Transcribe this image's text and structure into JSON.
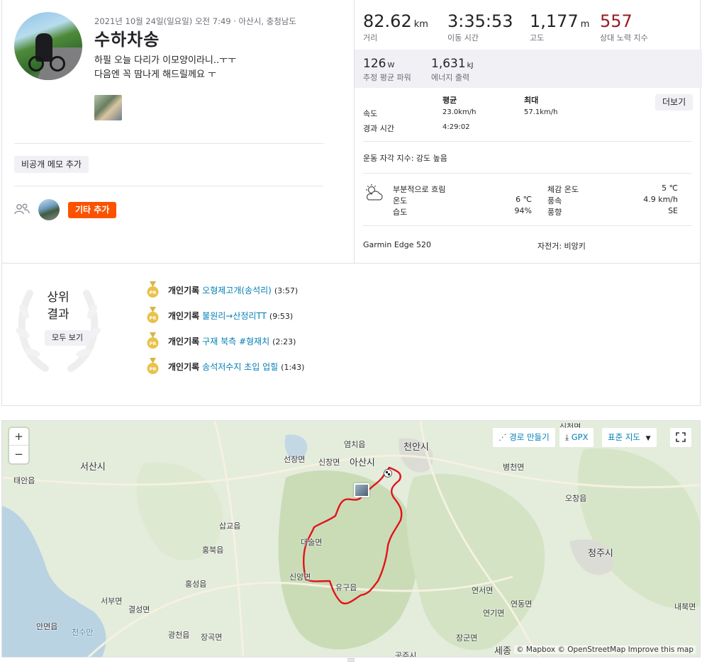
{
  "activity": {
    "meta": "2021년 10월 24일(일요일) 오전 7:49 · 아산시, 충청남도",
    "title": "수하차송",
    "description_line1": "하필 오늘 다리가 이모양이라니..ㅜㅜ",
    "description_line2": "다음엔 꼭 땀나게 해드릴께요 ㅜ",
    "private_note_button": "비공개 메모 추가",
    "add_other_button": "기타 추가"
  },
  "stats": [
    {
      "value": "82.62",
      "unit": "km",
      "label": "거리"
    },
    {
      "value": "3:35:53",
      "unit": "",
      "label": "이동 시간"
    },
    {
      "value": "1,177",
      "unit": "m",
      "label": "고도"
    },
    {
      "value": "557",
      "unit": "",
      "label": "상대 노력 지수"
    }
  ],
  "stats2": [
    {
      "value": "126",
      "unit": "W",
      "label": "추정 평균 파워"
    },
    {
      "value": "1,631",
      "unit": "kJ",
      "label": "에너지 출력"
    }
  ],
  "table": {
    "col_avg": "평균",
    "col_max": "최대",
    "more_button": "더보기",
    "speed_label": "속도",
    "speed_avg": "23.0km/h",
    "speed_max": "57.1km/h",
    "elapsed_label": "경과 시간",
    "elapsed_avg": "4:29:02"
  },
  "rpe": "운동 자각 지수: 강도 높음",
  "weather": {
    "condition": "부분적으로 흐림",
    "temp_label": "온도",
    "temp_value": "6 ℃",
    "humidity_label": "습도",
    "humidity_value": "94%",
    "feels_label": "체감 온도",
    "feels_value": "5 ℃",
    "wind_speed_label": "풍속",
    "wind_speed_value": "4.9 km/h",
    "wind_dir_label": "풍향",
    "wind_dir_value": "SE"
  },
  "device": "Garmin Edge 520",
  "bike": "자전거: 비앙키",
  "top_results": {
    "title_line1": "상위",
    "title_line2": "결과",
    "view_all": "모두 보기",
    "items": [
      {
        "kind": "개인기록",
        "segment": "오형제고개(송석리)",
        "time": "(3:57)"
      },
      {
        "kind": "개인기록",
        "segment": "불원리→산정리TT",
        "time": "(9:53)"
      },
      {
        "kind": "개인기록",
        "segment": "구재 북측 #형재치",
        "time": "(2:23)"
      },
      {
        "kind": "개인기록",
        "segment": "송석저수지 초입 업힐",
        "time": "(1:43)"
      }
    ]
  },
  "map": {
    "zoom_in": "+",
    "zoom_out": "−",
    "route_builder": "경로 만들기",
    "gpx": "GPX",
    "map_type": "표준 지도",
    "attribution": "© Mapbox © OpenStreetMap Improve this map",
    "places": [
      {
        "name": "천안시"
      },
      {
        "name": "아산시"
      },
      {
        "name": "염치읍"
      },
      {
        "name": "선장면"
      },
      {
        "name": "신창면"
      },
      {
        "name": "서산시"
      },
      {
        "name": "태안읍"
      },
      {
        "name": "병천면"
      },
      {
        "name": "오창읍"
      },
      {
        "name": "청주시"
      },
      {
        "name": "삽교읍"
      },
      {
        "name": "홍북읍"
      },
      {
        "name": "대술면"
      },
      {
        "name": "신양면"
      },
      {
        "name": "유구읍"
      },
      {
        "name": "홍성읍"
      },
      {
        "name": "서부면"
      },
      {
        "name": "결성면"
      },
      {
        "name": "안면읍"
      },
      {
        "name": "천수만"
      },
      {
        "name": "광천읍"
      },
      {
        "name": "장곡면"
      },
      {
        "name": "연서면"
      },
      {
        "name": "연기면"
      },
      {
        "name": "연동면"
      },
      {
        "name": "장군면"
      },
      {
        "name": "세종"
      },
      {
        "name": "공주시"
      },
      {
        "name": "내북면"
      },
      {
        "name": "신천면"
      }
    ]
  },
  "colors": {
    "brand_orange": "#fc5200",
    "suffer_red": "#9b1b22",
    "link_blue": "#007fb6",
    "route_red": "#e3131b"
  }
}
